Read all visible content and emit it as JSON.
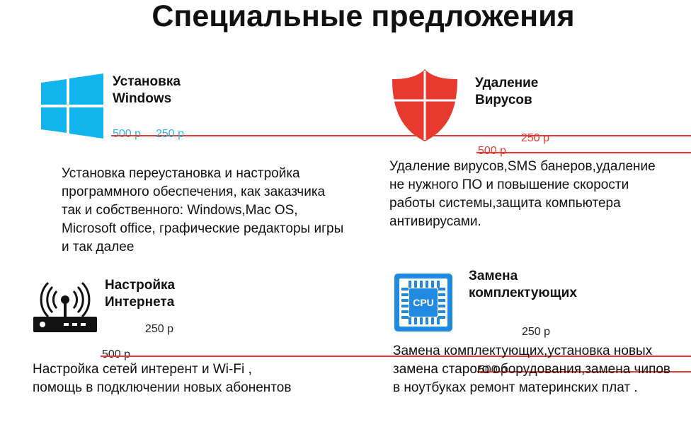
{
  "page": {
    "title": "Специальные предложения"
  },
  "offers": {
    "windows": {
      "icon": "windows-logo-icon",
      "name": "Установка\nWindows",
      "old_price": "500 р",
      "new_price": "250 р",
      "description": "Установка переустановка и настройка программного обеспечения, как заказчика так и собственного: Windows,Mac OS, Microsoft office, графические редакторы игры и так далее",
      "accent": "#2ab4e4"
    },
    "virus": {
      "icon": "shield-icon",
      "name": "Удаление\nВирусов",
      "old_price": "500 р",
      "new_price": "250 р",
      "description": "Удаление вирусов,SMS банеров,удаление не нужного ПО и повышение скорости работы системы,защита компьютера антивирусами.",
      "accent": "#e53935"
    },
    "internet": {
      "icon": "router-icon",
      "name": "Настройка\nИнтернета",
      "old_price": "500 р",
      "new_price": "250 р",
      "description": "Настройка сетей интерент и Wi-Fi , помощь в подключении новых абонентов",
      "accent": "#111111"
    },
    "hardware": {
      "icon": "cpu-chip-icon",
      "name": "Замена\nкомплектующих",
      "old_price": "500 р",
      "new_price": "250 р",
      "description": "Замена комплектующих,установка новых замена старого оборудования,замена чипов в ноутбуках ремонт материнских плат .",
      "accent": "#2f8fd8"
    }
  }
}
